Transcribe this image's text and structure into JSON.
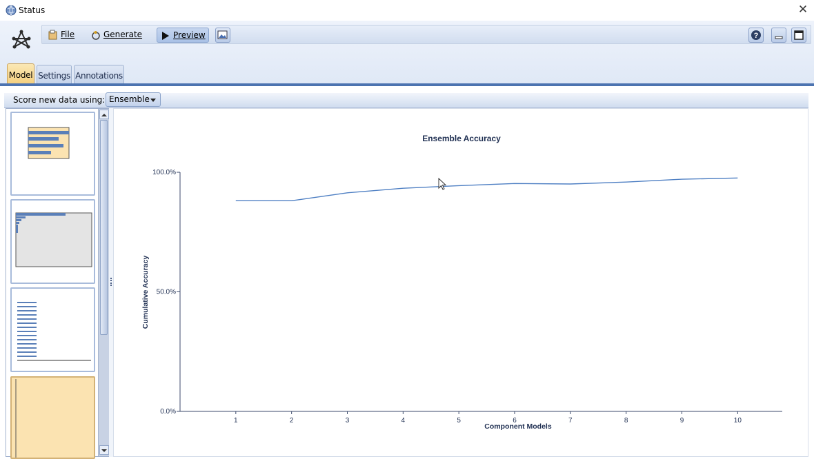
{
  "window": {
    "title": "Status"
  },
  "toolbar": {
    "file_label": "File",
    "generate_label": "Generate",
    "preview_label": "Preview"
  },
  "tabs": [
    {
      "label": "Model"
    },
    {
      "label": "Settings"
    },
    {
      "label": "Annotations"
    }
  ],
  "score": {
    "label": "Score new data using:",
    "selected": "Ensemble"
  },
  "colors": {
    "accent": "#4c73b0",
    "line": "#4e7fc3",
    "tab_active": "#f4cf7e"
  },
  "chart_data": {
    "type": "line",
    "title": "Ensemble Accuracy",
    "xlabel": "Component Models",
    "ylabel": "Cumulative Accuracy",
    "x": [
      1,
      2,
      3,
      4,
      5,
      6,
      7,
      8,
      9,
      10
    ],
    "xlim": [
      0,
      10.8
    ],
    "ylim": [
      0,
      100
    ],
    "y_ticks": [
      {
        "value": 0,
        "label": "0.0%"
      },
      {
        "value": 50,
        "label": "50.0%"
      },
      {
        "value": 100,
        "label": "100.0%"
      }
    ],
    "series": [
      {
        "values": [
          88.1,
          88.1,
          91.4,
          93.3,
          94.4,
          95.3,
          95.1,
          95.9,
          97.1,
          97.6
        ]
      }
    ],
    "grid": false
  }
}
